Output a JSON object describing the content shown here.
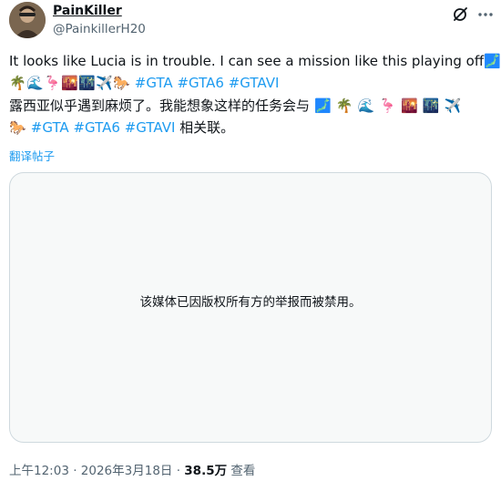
{
  "author": {
    "display_name": "PainKiller",
    "handle": "@PainkillerH20"
  },
  "header_icons": [
    "grok-icon",
    "more-options-icon"
  ],
  "post": {
    "text_en_main": "It looks like Lucia is in trouble. I can see a mission like this playing off",
    "text_zh_main": "露西亚似乎遇到麻烦了。我能想象这样的任务会与",
    "emoji": {
      "map": "🗾",
      "palm": "🌴",
      "wave": "🌊",
      "flamingo": "🦩",
      "sunset": "🌇",
      "night_city": "🌃",
      "plane": "✈️",
      "horse": "🐎"
    },
    "hashtags": [
      "#GTA",
      "#GTA6",
      "#GTAVI"
    ],
    "zh_suffix": "相关联。"
  },
  "translate_label": "翻译帖子",
  "media": {
    "blocked_message": "该媒体已因版权所有方的举报而被禁用。"
  },
  "meta": {
    "time_date": "上午12:03 · 2026年3月18日 · ",
    "views_count": "38.5万",
    "views_label": " 查看"
  },
  "colors": {
    "link": "#1d9bf0",
    "secondary_text": "#536471",
    "media_bg": "#f7f9f9",
    "border": "#cfd9de"
  }
}
